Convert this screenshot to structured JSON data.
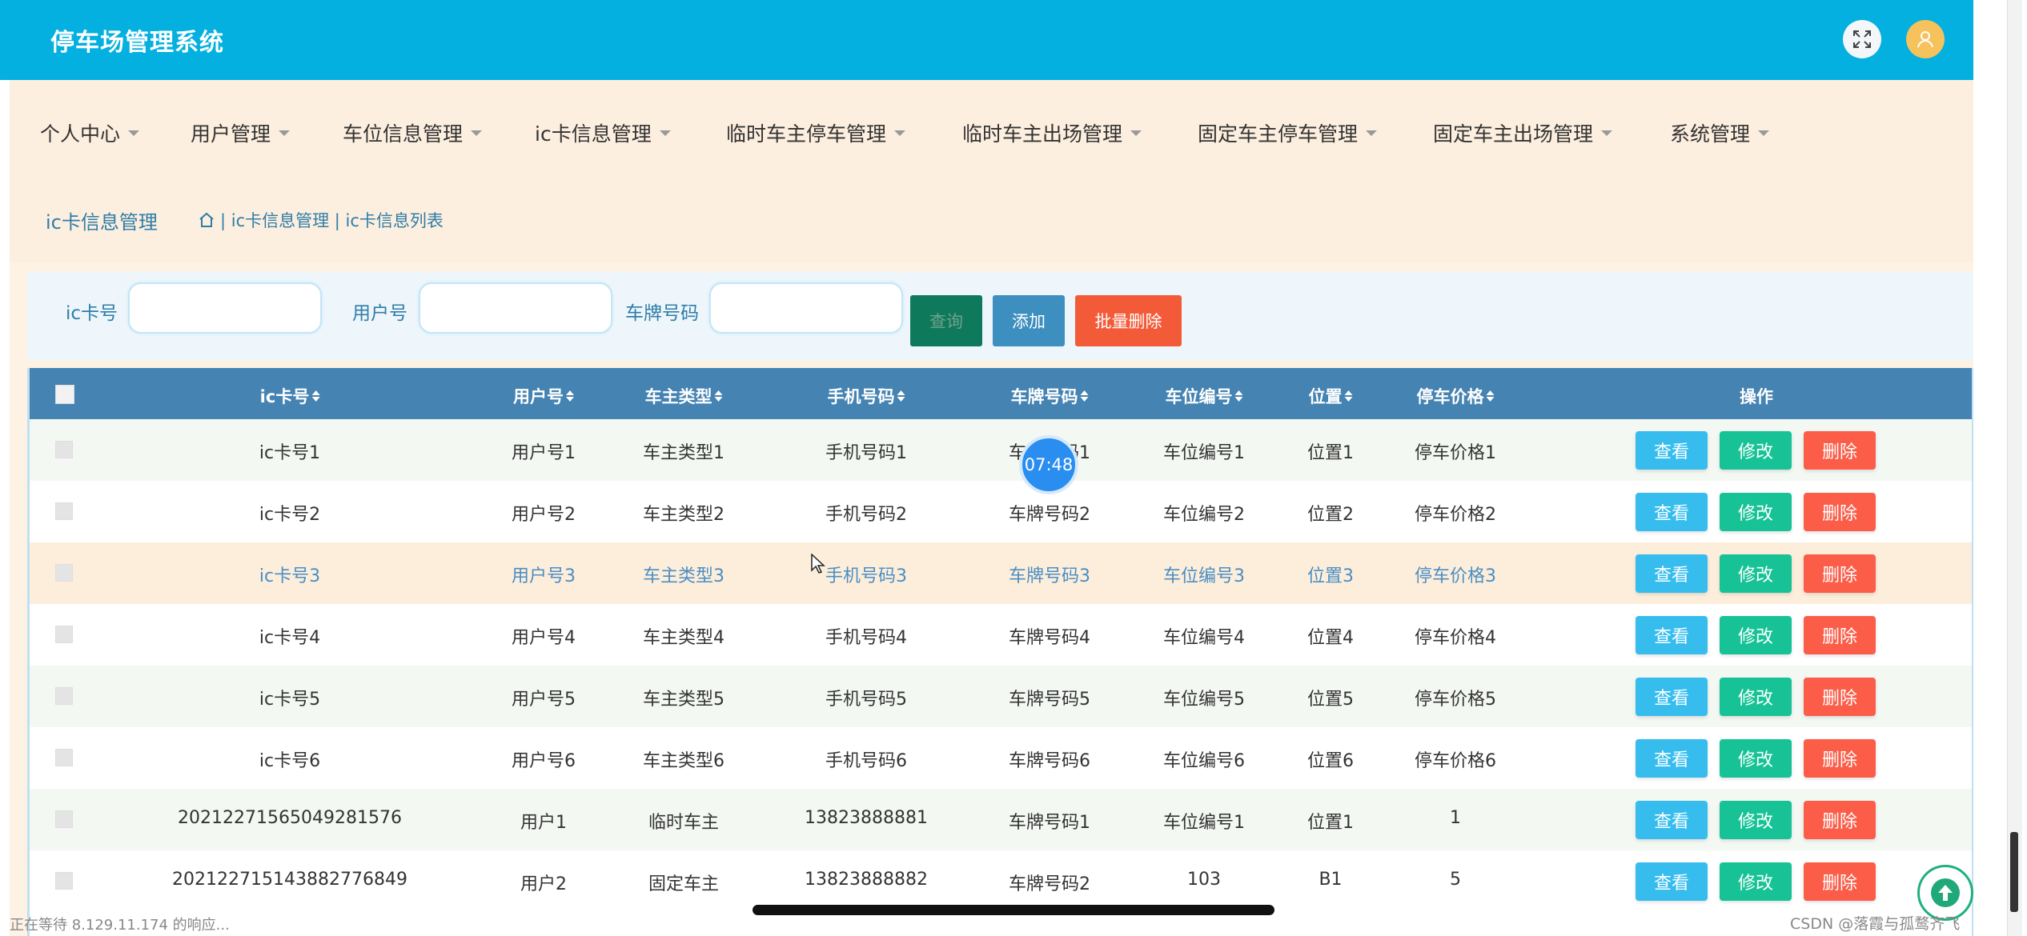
{
  "header": {
    "title": "停车场管理系统"
  },
  "nav": [
    {
      "label": "个人中心"
    },
    {
      "label": "用户管理"
    },
    {
      "label": "车位信息管理"
    },
    {
      "label": "ic卡信息管理"
    },
    {
      "label": "临时车主停车管理"
    },
    {
      "label": "临时车主出场管理"
    },
    {
      "label": "固定车主停车管理"
    },
    {
      "label": "固定车主出场管理"
    },
    {
      "label": "系统管理"
    }
  ],
  "breadcrumb": {
    "title": "ic卡信息管理",
    "path": "| ic卡信息管理 | ic卡信息列表"
  },
  "search": {
    "fields": [
      {
        "label": "ic卡号",
        "value": ""
      },
      {
        "label": "用户号",
        "value": ""
      },
      {
        "label": "车牌号码",
        "value": ""
      }
    ],
    "search_label": "查询",
    "add_label": "添加",
    "batch_delete_label": "批量删除"
  },
  "table": {
    "columns": [
      "ic卡号",
      "用户号",
      "车主类型",
      "手机号码",
      "车牌号码",
      "车位编号",
      "位置",
      "停车价格",
      "操作"
    ],
    "rows": [
      [
        "ic卡号1",
        "用户号1",
        "车主类型1",
        "手机号码1",
        "车牌号码1",
        "车位编号1",
        "位置1",
        "停车价格1"
      ],
      [
        "ic卡号2",
        "用户号2",
        "车主类型2",
        "手机号码2",
        "车牌号码2",
        "车位编号2",
        "位置2",
        "停车价格2"
      ],
      [
        "ic卡号3",
        "用户号3",
        "车主类型3",
        "手机号码3",
        "车牌号码3",
        "车位编号3",
        "位置3",
        "停车价格3"
      ],
      [
        "ic卡号4",
        "用户号4",
        "车主类型4",
        "手机号码4",
        "车牌号码4",
        "车位编号4",
        "位置4",
        "停车价格4"
      ],
      [
        "ic卡号5",
        "用户号5",
        "车主类型5",
        "手机号码5",
        "车牌号码5",
        "车位编号5",
        "位置5",
        "停车价格5"
      ],
      [
        "ic卡号6",
        "用户号6",
        "车主类型6",
        "手机号码6",
        "车牌号码6",
        "车位编号6",
        "位置6",
        "停车价格6"
      ],
      [
        "20212271565049281576",
        "用户1",
        "临时车主",
        "13823888881",
        "车牌号码1",
        "车位编号1",
        "位置1",
        "1"
      ],
      [
        "20212271514388277684​9",
        "用户2",
        "固定车主",
        "13823888882",
        "车牌号码2",
        "103",
        "B1",
        "5"
      ]
    ],
    "actions": {
      "view": "查看",
      "edit": "修改",
      "delete": "删除"
    }
  },
  "overlay": {
    "timer": "07:48",
    "status": "正在等待 8.129.11.174 的响应...",
    "watermark": "CSDN @落霞与孤鹜齐飞"
  },
  "colors": {
    "header": "#03b0e0",
    "nav_bg": "#fdefdf",
    "table_header": "#4583b2",
    "view_button": "#36bdee",
    "edit_button": "#17c396",
    "delete_button": "#fb5d49"
  }
}
